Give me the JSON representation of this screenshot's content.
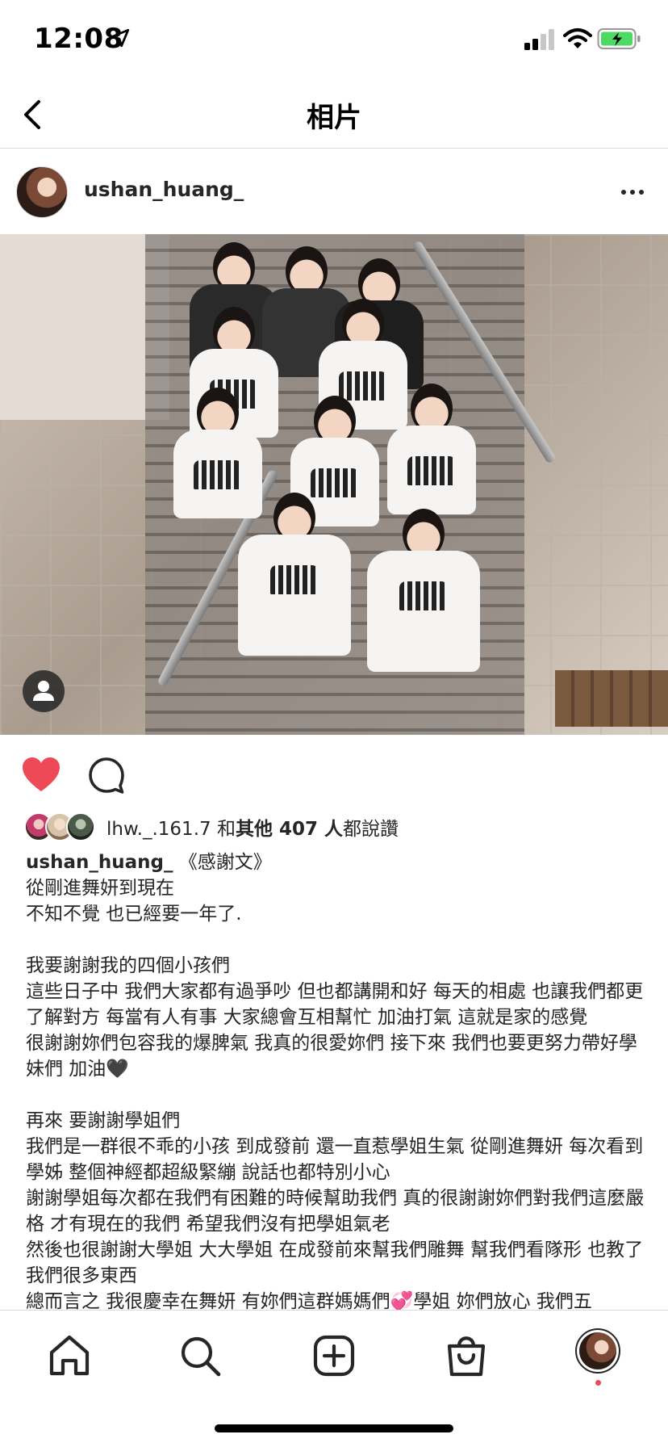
{
  "status_bar": {
    "time": "12:08",
    "icons": [
      "location-arrow-icon",
      "signal-bars-icon",
      "wifi-icon",
      "battery-charging-icon"
    ],
    "battery_color": "#4cd964"
  },
  "nav": {
    "title": "相片",
    "back_icon": "chevron-left-icon"
  },
  "post": {
    "username": "ushan_huang_",
    "more_icon": "more-horizontal-icon",
    "actions": {
      "liked": true,
      "like_color": "#ed4956"
    },
    "likes": {
      "first_liker": "lhw._.161.7",
      "connector": " 和",
      "others": "其他 407 人",
      "suffix": "都說讚"
    },
    "caption": {
      "username": "ushan_huang_",
      "title": " 《感謝文》",
      "body": "從剛進舞妍到現在\n不知不覺 也已經要一年了.\n\n我要謝謝我的四個小孩們\n這些日子中 我們大家都有過爭吵 但也都講開和好 每天的相處 也讓我們都更了解對方 每當有人有事 大家總會互相幫忙 加油打氣 這就是家的感覺\n很謝謝妳們包容我的爆脾氣 我真的很愛妳們 接下來 我們也要更努力帶好學妹們 加油🖤\n\n再來 要謝謝學姐們\n我們是一群很不乖的小孩 到成發前 還一直惹學姐生氣 從剛進舞妍 每次看到學姊 整個神經都超級緊繃 說話也都特別小心\n謝謝學姐每次都在我們有困難的時候幫助我們 真的很謝謝妳們對我們這麼嚴格 才有現在的我們 希望我們沒有把學姐氣老\n然後也很謝謝大學姐 大大學姐 在成發前來幫我們雕舞 幫我們看隊形 也教了我們很多東西\n總而言之 我很慶幸在舞妍 有妳們這群媽媽們💞學姐 妳們放心 我們五"
    }
  },
  "tab_bar": {
    "tabs": [
      "home-icon",
      "search-icon",
      "new-post-icon",
      "shop-icon",
      "profile-avatar"
    ]
  }
}
